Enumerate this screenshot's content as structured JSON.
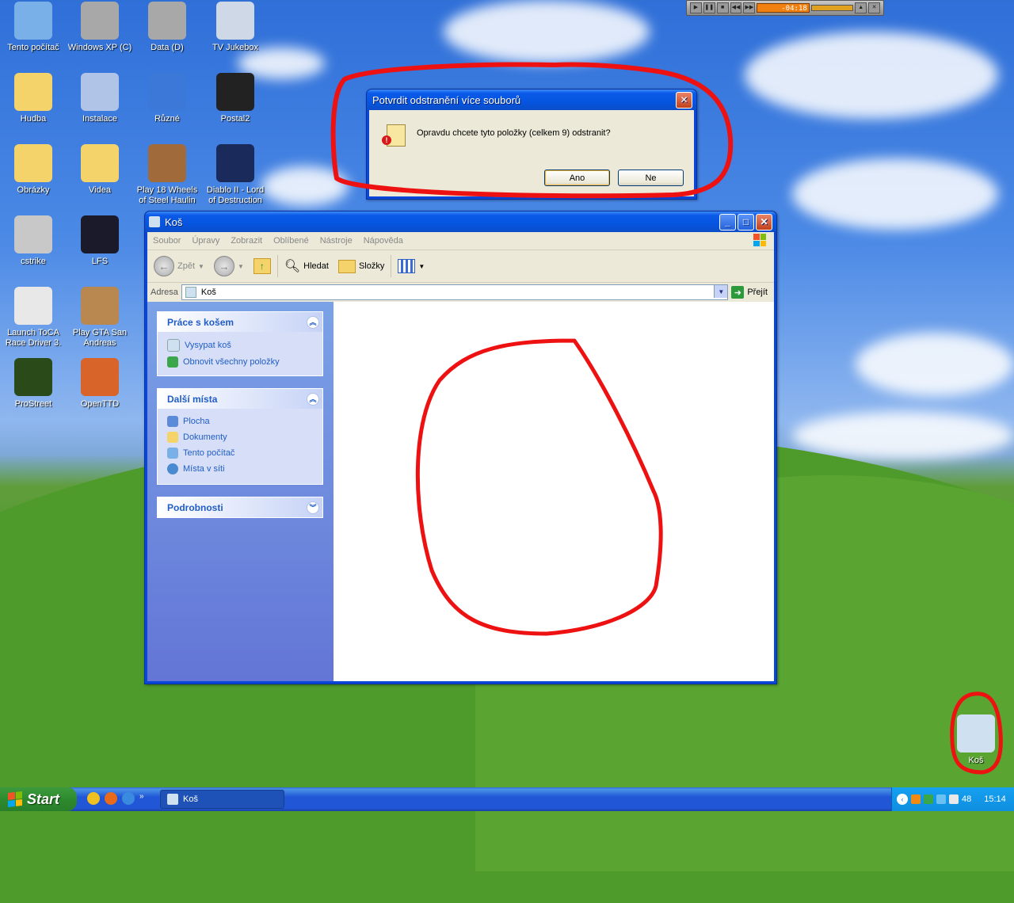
{
  "desktop": {
    "icons": [
      {
        "label": "Tento počítač",
        "icon": "my-computer-icon",
        "color": "#7ab0e8"
      },
      {
        "label": "Windows XP (C)",
        "icon": "hard-drive-icon",
        "color": "#a8a8a8"
      },
      {
        "label": "Data (D)",
        "icon": "hard-drive-icon",
        "color": "#a8a8a8"
      },
      {
        "label": "TV Jukebox",
        "icon": "tv-icon",
        "color": "#cfd8e6"
      },
      {
        "label": "Hudba",
        "icon": "music-folder-icon",
        "color": "#f3d36a"
      },
      {
        "label": "Instalace",
        "icon": "setup-icon",
        "color": "#b0c4e8"
      },
      {
        "label": "Různé",
        "icon": "help-icon",
        "color": "#3b78d8"
      },
      {
        "label": "Postal2",
        "icon": "postal2-icon",
        "color": "#222222"
      },
      {
        "label": "Obrázky",
        "icon": "pictures-folder-icon",
        "color": "#f3d36a"
      },
      {
        "label": "Videa",
        "icon": "video-folder-icon",
        "color": "#f3d36a"
      },
      {
        "label": "Play 18 Wheels of Steel Haulin",
        "icon": "truck-game-icon",
        "color": "#a06a3a"
      },
      {
        "label": "Diablo II - Lord of Destruction",
        "icon": "diablo-icon",
        "color": "#1a2a5a"
      },
      {
        "label": "cstrike",
        "icon": "counter-strike-icon",
        "color": "#c8c8c8"
      },
      {
        "label": "LFS",
        "icon": "lfs-icon",
        "color": "#1a1a2a"
      },
      {
        "label": "Launch ToCA Race Driver 3.",
        "icon": "toca-icon",
        "color": "#e8e8e8"
      },
      {
        "label": "Play GTA San Andreas",
        "icon": "gta-icon",
        "color": "#b88850"
      },
      {
        "label": "ProStreet",
        "icon": "prostreet-icon",
        "color": "#2a4a1a"
      },
      {
        "label": "OpenTTD",
        "icon": "openttd-icon",
        "color": "#d8642a"
      },
      {
        "label": "Koš",
        "icon": "recycle-bin-icon",
        "color": "#cfe0f0"
      }
    ]
  },
  "media_player": {
    "time": "-04:18"
  },
  "dialog": {
    "title": "Potvrdit odstranění více souborů",
    "message": "Opravdu chcete tyto položky (celkem 9) odstranit?",
    "yes_label": "Ano",
    "no_label": "Ne"
  },
  "explorer": {
    "title": "Koš",
    "menu": [
      "Soubor",
      "Úpravy",
      "Zobrazit",
      "Oblíbené",
      "Nástroje",
      "Nápověda"
    ],
    "toolbar": {
      "back": "Zpět",
      "search": "Hledat",
      "folders": "Složky"
    },
    "address_label": "Adresa",
    "address_value": "Koš",
    "go_label": "Přejít",
    "panels": [
      {
        "title": "Práce s košem",
        "items": [
          "Vysypat koš",
          "Obnovit všechny položky"
        ]
      },
      {
        "title": "Další místa",
        "items": [
          "Plocha",
          "Dokumenty",
          "Tento počítač",
          "Místa v síti"
        ]
      },
      {
        "title": "Podrobnosti",
        "items": []
      }
    ]
  },
  "taskbar": {
    "start_label": "Start",
    "window_label": "Koš",
    "tray_text": "48",
    "clock": "15:14"
  },
  "colors": {
    "annotation_red": "#ee1111",
    "xp_blue": "#0a5ae8",
    "taskpane_link": "#215dc6"
  }
}
